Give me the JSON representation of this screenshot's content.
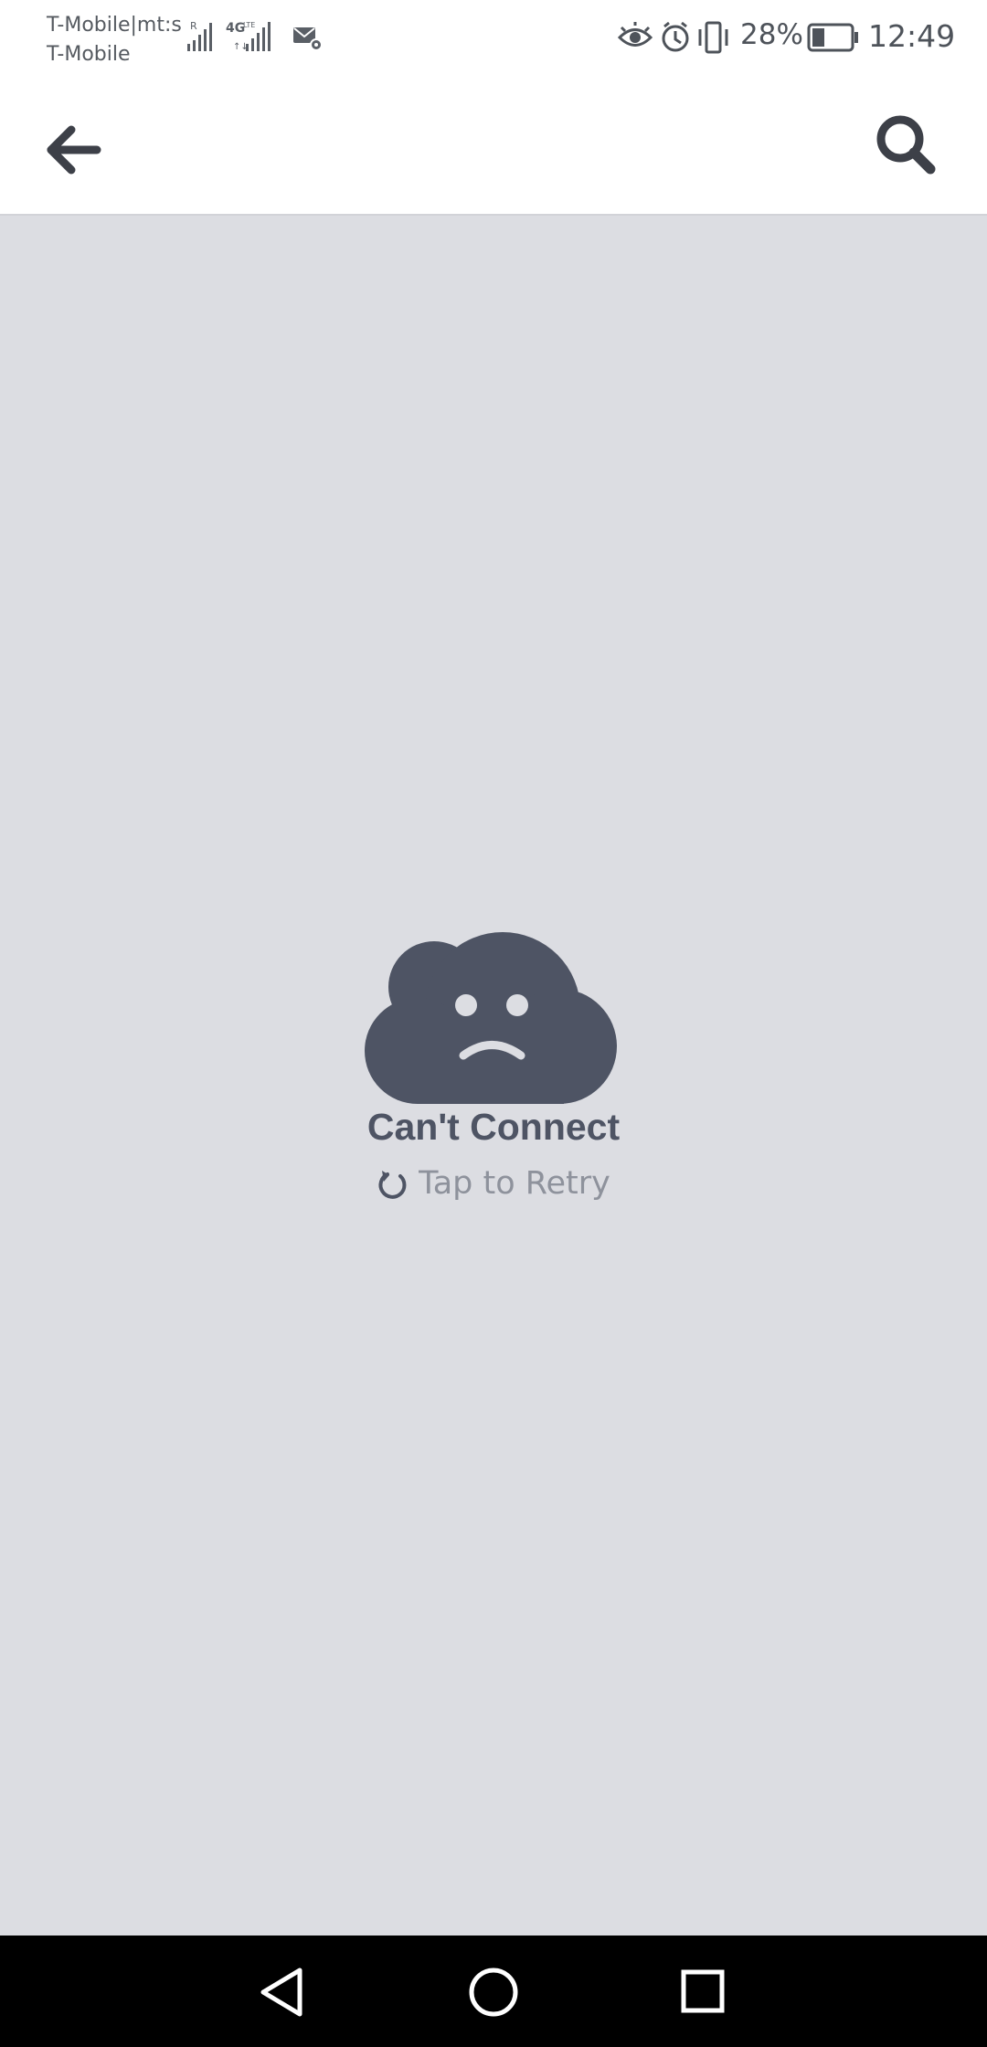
{
  "status_bar": {
    "carrier_line1": "T-Mobile|mt:s",
    "carrier_line2": "T-Mobile",
    "battery_percent": "28%",
    "time": "12:49",
    "icons": [
      "signal-roaming-icon",
      "signal-4g-lte-icon",
      "mail-settings-icon",
      "eye-icon",
      "alarm-icon",
      "vibrate-icon",
      "battery-icon"
    ]
  },
  "app_bar": {
    "back_icon": "arrow-left-icon",
    "search_icon": "search-icon"
  },
  "error": {
    "icon": "sad-cloud-icon",
    "title": "Can't Connect",
    "retry_icon": "refresh-icon",
    "retry_label": "Tap to Retry"
  },
  "nav_bar": {
    "items": [
      "back-triangle-icon",
      "home-circle-icon",
      "recents-square-icon"
    ]
  },
  "colors": {
    "background": "#dcdde2",
    "icon_dark": "#4e5464",
    "muted_text": "#8e929c",
    "nav_bar": "#000000"
  }
}
